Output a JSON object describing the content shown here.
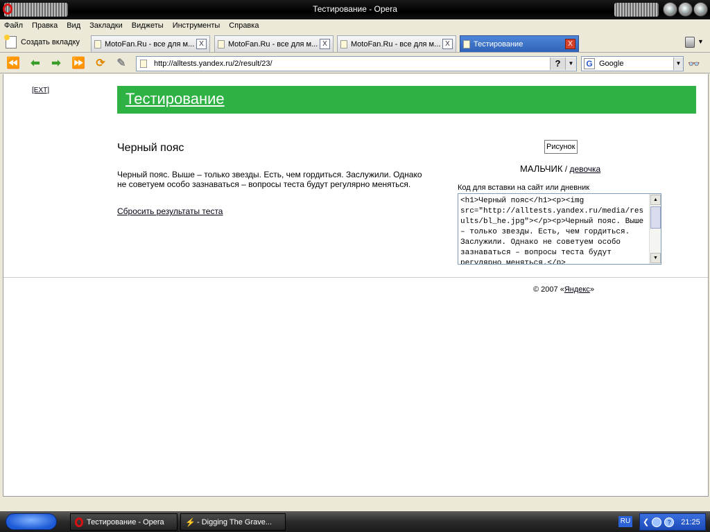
{
  "window": {
    "title": "Тестирование - Opera"
  },
  "menu": [
    "Файл",
    "Правка",
    "Вид",
    "Закладки",
    "Виджеты",
    "Инструменты",
    "Справка"
  ],
  "tabs": {
    "new_tab_label": "Создать вкладку",
    "items": [
      {
        "label": "MotoFan.Ru - все для м...",
        "active": false
      },
      {
        "label": "MotoFan.Ru - все для м...",
        "active": false
      },
      {
        "label": "MotoFan.Ru - все для м...",
        "active": false
      },
      {
        "label": "Тестирование",
        "active": true
      }
    ],
    "close_glyph": "X"
  },
  "toolbar": {
    "address": "http://alltests.yandex.ru/2/result/23/",
    "help_glyph": "?",
    "search_engine": "Google"
  },
  "page": {
    "ext_link": "[EXT]",
    "header_title": "Тестирование",
    "result_title": "Черный пояс",
    "result_text": "Черный пояс. Выше – только звезды. Есть, чем гордиться. Заслужили. Однако не советуем особо зазнаваться – вопросы теста будут регулярно меняться.",
    "reset_link": "Сбросить результаты теста",
    "picture_alt": "Рисунок",
    "gender_boy": "МАЛЬЧИК",
    "gender_sep": " / ",
    "gender_girl": "девочка",
    "embed_label": "Код для вставки на сайт или дневник",
    "embed_code": "<h1>Черный пояс</h1><p><img src=\"http://alltests.yandex.ru/media/results/bl_he.jpg\"></p><p>Черный пояс. Выше – только звезды. Есть, чем гордиться. Заслужили. Однако не советуем особо зазнаваться – вопросы теста будут регулярно меняться.</p>",
    "footer_prefix": "© 2007 «",
    "footer_link": "Яндекс",
    "footer_suffix": "»"
  },
  "taskbar": {
    "tasks": [
      {
        "label": "Тестирование - Opera"
      },
      {
        "label": "- Digging The Grave..."
      }
    ],
    "lang": "RU",
    "clock": "21:25"
  },
  "colors": {
    "header_green": "#2fb244",
    "active_tab": "#2e63b8"
  }
}
